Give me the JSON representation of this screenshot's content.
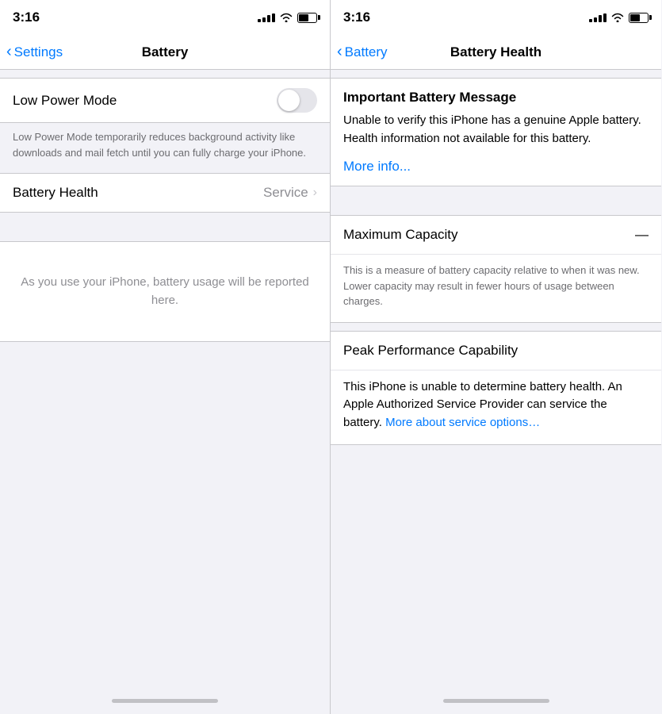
{
  "left_panel": {
    "status": {
      "time": "3:16"
    },
    "nav": {
      "back_label": "Settings",
      "title": "Battery"
    },
    "low_power": {
      "label": "Low Power Mode",
      "description": "Low Power Mode temporarily reduces background activity like downloads and mail fetch until you can fully charge your iPhone."
    },
    "battery_health": {
      "label": "Battery Health",
      "value": "Service"
    },
    "usage_placeholder": "As you use your iPhone, battery usage will be reported here."
  },
  "right_panel": {
    "status": {
      "time": "3:16"
    },
    "nav": {
      "back_label": "Battery",
      "title": "Battery Health"
    },
    "important": {
      "title": "Important Battery Message",
      "body": "Unable to verify this iPhone has a genuine Apple battery. Health information not available for this battery.",
      "link": "More info..."
    },
    "maximum_capacity": {
      "title": "Maximum Capacity",
      "dash": "—",
      "description": "This is a measure of battery capacity relative to when it was new. Lower capacity may result in fewer hours of usage between charges."
    },
    "peak_performance": {
      "title": "Peak Performance Capability",
      "body_prefix": "This iPhone is unable to determine battery health. An Apple Authorized Service Provider can service the battery. ",
      "link": "More about service options…"
    }
  }
}
